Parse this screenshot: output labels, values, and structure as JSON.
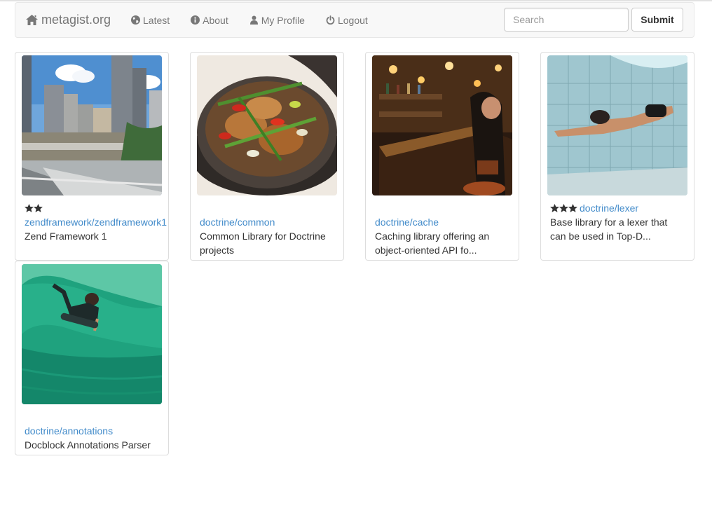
{
  "navbar": {
    "brand": "metagist.org",
    "items": [
      {
        "label": "Latest",
        "icon": "globe-icon"
      },
      {
        "label": "About",
        "icon": "info-icon"
      },
      {
        "label": "My Profile",
        "icon": "user-icon"
      },
      {
        "label": "Logout",
        "icon": "power-icon"
      }
    ],
    "search_placeholder": "Search",
    "submit_label": "Submit"
  },
  "packages": [
    {
      "name": "zendframework/zendframework1",
      "description": "Zend Framework 1",
      "rating": 2,
      "image": "city-skyline"
    },
    {
      "name": "doctrine/common",
      "description": "Common Library for Doctrine projects",
      "rating": 0,
      "image": "food-bowl"
    },
    {
      "name": "doctrine/cache",
      "description": "Caching library offering an object-oriented API fo...",
      "rating": 0,
      "image": "bar-interior"
    },
    {
      "name": "doctrine/lexer",
      "description": "Base library for a lexer that can be used in Top-D...",
      "rating": 3,
      "image": "underwater-swimmer"
    },
    {
      "name": "doctrine/annotations",
      "description": "Docblock Annotations Parser",
      "rating": 0,
      "image": "surfer-wave"
    }
  ],
  "colors": {
    "link": "#428bca",
    "navbar_bg": "#f8f8f8",
    "nav_text": "#777777"
  }
}
